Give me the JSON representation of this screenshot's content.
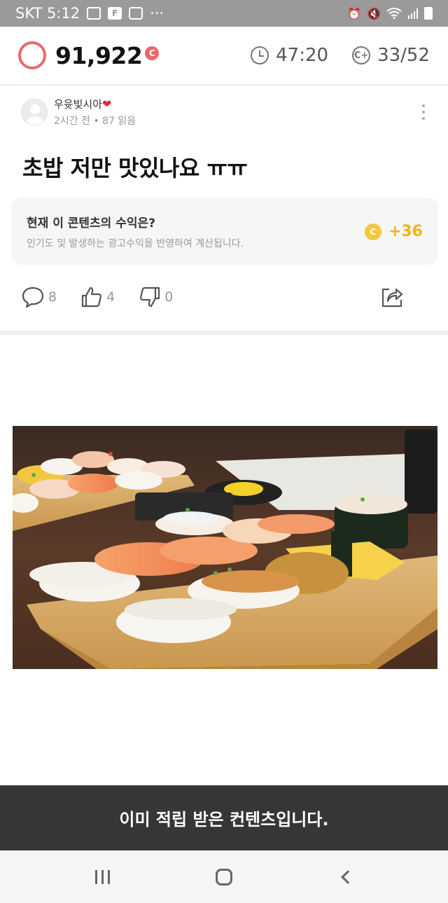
{
  "status_bar": {
    "carrier_time": "SKT 5:12",
    "icons": [
      "image-icon",
      "f-app-icon",
      "record-icon",
      "more-dots-icon",
      "alarm-icon",
      "mute-icon",
      "wifi-icon",
      "signal-icon",
      "battery-icon"
    ],
    "f_icon_label": "F",
    "dots": "···"
  },
  "header": {
    "points": "91,922",
    "coin_label": "C",
    "timer": "47:20",
    "cplus_label": "C+",
    "counter": "33/52",
    "accent_color": "#e8686c"
  },
  "post": {
    "author": "우윳빛시아",
    "heart": "❤",
    "meta": "2시간 전 • 87 읽음",
    "title": "초밥 저만 맛있나요 ㅠㅠ"
  },
  "revenue": {
    "title": "현재 이 콘텐츠의 수익은?",
    "description": "인기도 및 발생하는 광고수익을 반영하여 계산됩니다.",
    "coin_label": "C",
    "amount": "+36",
    "color": "#f0b51e"
  },
  "actions": {
    "comments": "8",
    "likes": "4",
    "dislikes": "0"
  },
  "image": {
    "description_icon": "sushi-photo"
  },
  "toast": {
    "message": "이미 적립 받은 컨텐츠입니다."
  }
}
